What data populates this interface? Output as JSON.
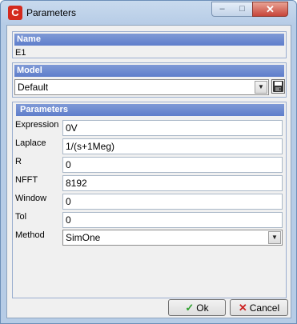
{
  "window": {
    "title": "Parameters",
    "app_icon": "simulator-logo-icon",
    "controls": {
      "minimize": "–",
      "maximize": "□",
      "close": "✕"
    }
  },
  "name_group": {
    "header": "Name",
    "value": "E1"
  },
  "model_group": {
    "header": "Model",
    "selected": "Default",
    "save_icon": "floppy-disk-icon"
  },
  "params_group": {
    "header": "Parameters",
    "rows": [
      {
        "label": "Expression",
        "value": "0V"
      },
      {
        "label": "Laplace",
        "value": "1/(s+1Meg)"
      },
      {
        "label": "R",
        "value": "0"
      },
      {
        "label": "NFFT",
        "value": "8192"
      },
      {
        "label": "Window",
        "value": "0"
      },
      {
        "label": "Tol",
        "value": "0"
      }
    ],
    "method": {
      "label": "Method",
      "selected": "SimOne"
    }
  },
  "buttons": {
    "ok": "Ok",
    "ok_icon": "checkmark-icon",
    "cancel": "Cancel",
    "cancel_icon": "x-icon"
  },
  "colors": {
    "header_blue": "#6a86cf",
    "title_bar": "#b6cce6",
    "ok_green": "#2ea02e",
    "cancel_red": "#cc2020"
  }
}
